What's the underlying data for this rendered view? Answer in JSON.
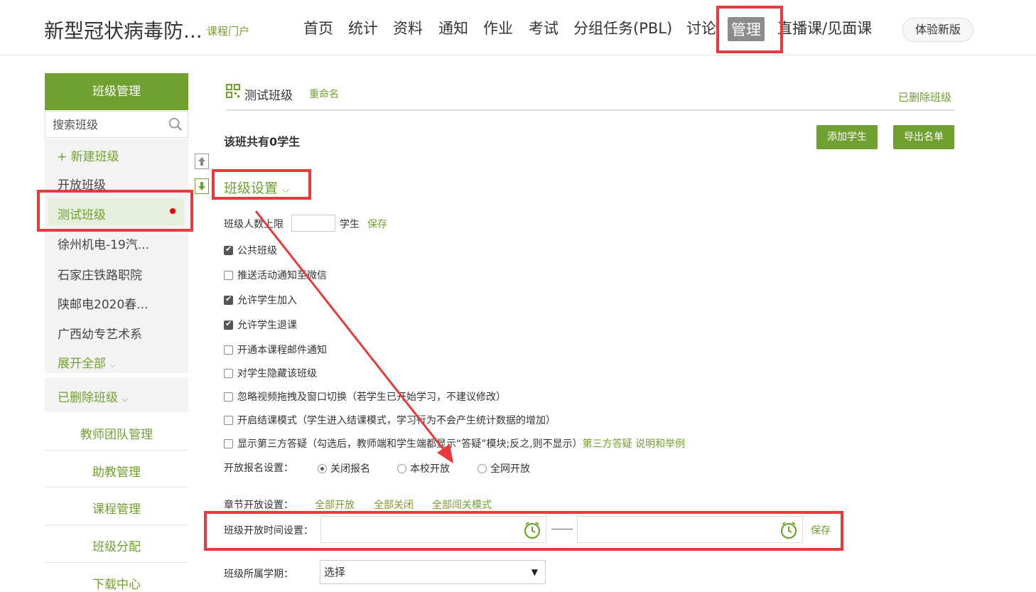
{
  "header": {
    "course_title": "新型冠状病毒防...",
    "portal_link": "课程门户",
    "nav": [
      "首页",
      "统计",
      "资料",
      "通知",
      "作业",
      "考试",
      "分组任务(PBL)",
      "讨论",
      "管理",
      "直播课/见面课"
    ],
    "active_nav": "管理",
    "try_new": "体验新版"
  },
  "sidebar": {
    "title": "班级管理",
    "search_placeholder": "搜索班级",
    "new_class": "+ 新建班级",
    "items": [
      "开放班级",
      "测试班级",
      "徐州机电-19汽...",
      "石家庄铁路职院",
      "陕邮电2020春...",
      "广西幼专艺术系"
    ],
    "active_item": "测试班级",
    "expand_all": "展开全部",
    "deleted_classes": "已删除班级",
    "links": [
      "教师团队管理",
      "助教管理",
      "课程管理",
      "班级分配",
      "下载中心"
    ]
  },
  "main": {
    "class_name": "测试班级",
    "rename": "重命名",
    "deleted_link": "已删除班级",
    "student_count": "该班共有0学生",
    "add_student": "添加学生",
    "export_list": "导出名单",
    "settings_title": "班级设置",
    "limit_label": "班级人数上限",
    "limit_unit": "学生",
    "limit_save": "保存",
    "options": [
      {
        "label": "公共班级",
        "checked": true
      },
      {
        "label": "推送活动通知至微信",
        "checked": false
      },
      {
        "label": "允许学生加入",
        "checked": true
      },
      {
        "label": "允许学生退课",
        "checked": true
      },
      {
        "label": "开通本课程邮件通知",
        "checked": false
      },
      {
        "label": "对学生隐藏该班级",
        "checked": false
      },
      {
        "label": "忽略视频拖拽及窗口切换（若学生已开始学习，不建议修改）",
        "checked": false
      },
      {
        "label": "开启结课模式（学生进入结课模式，学习行为不会产生统计数据的增加）",
        "checked": false
      },
      {
        "label": "显示第三方答疑（勾选后，教师端和学生端都显示“答疑”模块;反之,则不显示）",
        "checked": false
      }
    ],
    "third_party_link": "第三方答疑 说明和举例",
    "signup_label": "开放报名设置：",
    "signup_options": [
      "关闭报名",
      "本校开放",
      "全网开放"
    ],
    "signup_selected": "关闭报名",
    "chapter_label": "章节开放设置：",
    "chapter_links": [
      "全部开放",
      "全部关闭",
      "全部闯关模式"
    ],
    "time_label": "班级开放时间设置：",
    "time_save": "保存",
    "term_label": "班级所属学期：",
    "term_select": "选择"
  },
  "colors": {
    "accent": "#70a030",
    "highlight": "#e83a3a"
  }
}
